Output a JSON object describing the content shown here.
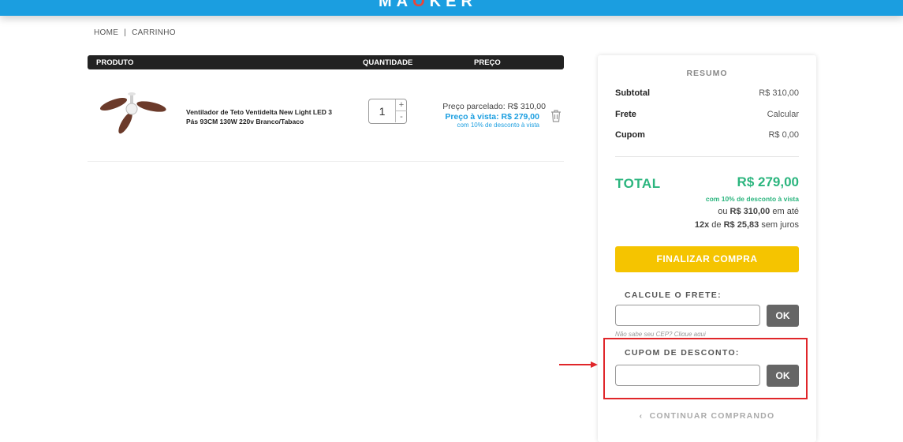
{
  "header": {
    "logo_left": "MA",
    "logo_highlight": "O",
    "logo_right": "KER"
  },
  "breadcrumb": {
    "home": "HOME",
    "separator": "|",
    "current": "CARRINHO"
  },
  "cart": {
    "columns": {
      "product": "PRODUTO",
      "quantity": "QUANTIDADE",
      "price": "PREÇO"
    },
    "item": {
      "name": "Ventilador de Teto Ventidelta New Light LED 3 Pás 93CM 130W 220v Branco/Tabaco",
      "quantity": "1",
      "qty_plus": "+",
      "qty_minus": "-",
      "price_installment": "Preço parcelado: R$ 310,00",
      "price_cash": "Preço à vista: R$ 279,00",
      "price_cash_note": "com 10% de desconto à vista",
      "delete_icon": "trash-icon"
    }
  },
  "summary": {
    "title": "RESUMO",
    "subtotal_label": "Subtotal",
    "subtotal_value": "R$ 310,00",
    "shipping_label": "Frete",
    "shipping_value": "Calcular",
    "coupon_label": "Cupom",
    "coupon_value": "R$ 0,00",
    "total_label": "TOTAL",
    "total_value": "R$ 279,00",
    "total_note": "com 10% de desconto à vista",
    "inst_or": "ou",
    "inst_total": "R$ 310,00",
    "inst_until": "em até",
    "inst_count": "12x",
    "inst_of": "de",
    "inst_value": "R$ 25,83",
    "inst_suffix": "sem juros",
    "finalize_label": "FINALIZAR COMPRA",
    "shipping_calc_label": "CALCULE O FRETE:",
    "shipping_ok": "OK",
    "cep_help": "Não sabe seu CEP? Clique aqui",
    "coupon_section_label": "CUPOM DE DESCONTO:",
    "coupon_ok": "OK",
    "continue_label": "CONTINUAR COMPRANDO",
    "continue_icon": "chevron-left-icon"
  },
  "colors": {
    "brand_blue": "#1b9ee0",
    "total_green": "#2bb57e",
    "finalize_yellow": "#f5c400",
    "annotation_red": "#e0262a"
  }
}
